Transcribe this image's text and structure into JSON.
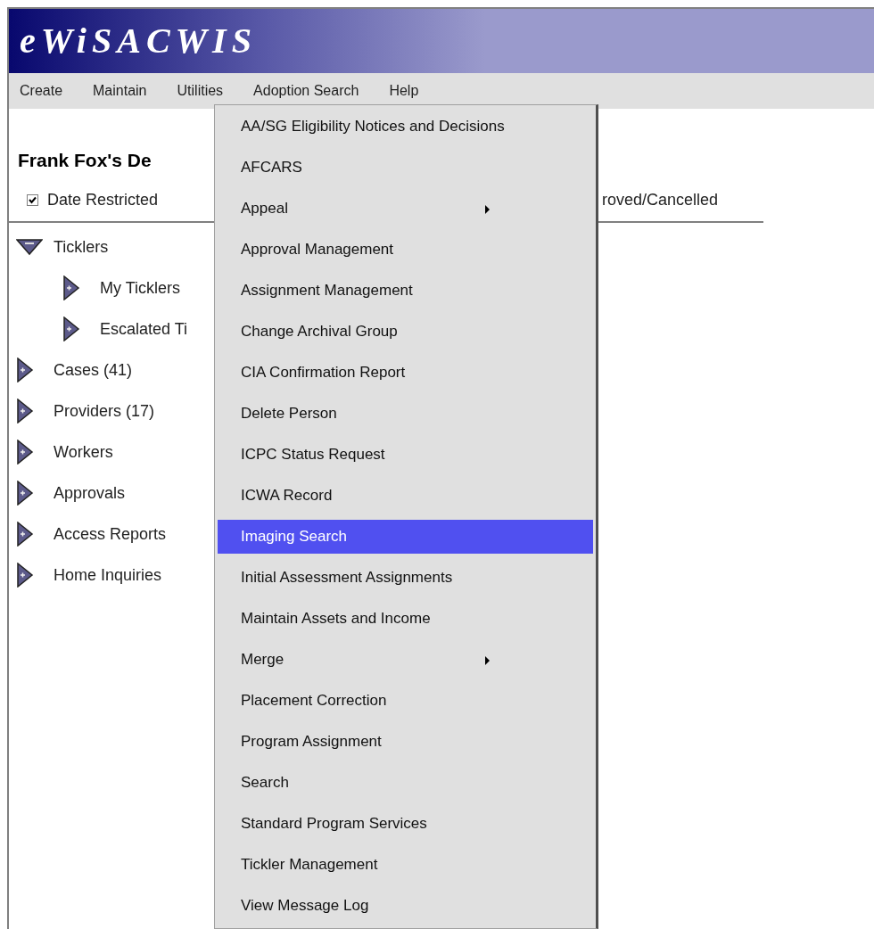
{
  "app": {
    "title": "eWiSACWIS"
  },
  "menu_bar": [
    {
      "label": "Create"
    },
    {
      "label": "Maintain"
    },
    {
      "label": "Utilities"
    },
    {
      "label": "Adoption Search"
    },
    {
      "label": "Help"
    }
  ],
  "page": {
    "heading": "Frank Fox's De",
    "filters": [
      {
        "label": "Date Restricted",
        "checked": true
      }
    ],
    "filter_tail": "roved/Cancelled"
  },
  "tree": [
    {
      "label": "Ticklers",
      "expanded": true,
      "children": [
        {
          "label": "My Ticklers",
          "expanded": false
        },
        {
          "label": "Escalated Ti",
          "expanded": false
        }
      ]
    },
    {
      "label": "Cases (41)",
      "expanded": false
    },
    {
      "label": "Providers (17)",
      "expanded": false
    },
    {
      "label": "Workers",
      "expanded": false
    },
    {
      "label": "Approvals",
      "expanded": false
    },
    {
      "label": "Access Reports",
      "expanded": false
    },
    {
      "label": "Home Inquiries",
      "expanded": false
    }
  ],
  "dropdown": [
    {
      "label": "AA/SG Eligibility Notices and Decisions",
      "submenu": false,
      "selected": false
    },
    {
      "label": "AFCARS",
      "submenu": false,
      "selected": false
    },
    {
      "label": "Appeal",
      "submenu": true,
      "selected": false
    },
    {
      "label": "Approval Management",
      "submenu": false,
      "selected": false
    },
    {
      "label": "Assignment Management",
      "submenu": false,
      "selected": false
    },
    {
      "label": "Change Archival Group",
      "submenu": false,
      "selected": false
    },
    {
      "label": "CIA Confirmation Report",
      "submenu": false,
      "selected": false
    },
    {
      "label": "Delete Person",
      "submenu": false,
      "selected": false
    },
    {
      "label": "ICPC Status Request",
      "submenu": false,
      "selected": false
    },
    {
      "label": "ICWA Record",
      "submenu": false,
      "selected": false
    },
    {
      "label": "Imaging Search",
      "submenu": false,
      "selected": true
    },
    {
      "label": "Initial Assessment Assignments",
      "submenu": false,
      "selected": false
    },
    {
      "label": "Maintain Assets and Income",
      "submenu": false,
      "selected": false
    },
    {
      "label": "Merge",
      "submenu": true,
      "selected": false
    },
    {
      "label": "Placement Correction",
      "submenu": false,
      "selected": false
    },
    {
      "label": "Program Assignment",
      "submenu": false,
      "selected": false
    },
    {
      "label": "Search",
      "submenu": false,
      "selected": false
    },
    {
      "label": "Standard Program Services",
      "submenu": false,
      "selected": false
    },
    {
      "label": "Tickler Management",
      "submenu": false,
      "selected": false
    },
    {
      "label": "View Message Log",
      "submenu": false,
      "selected": false
    }
  ]
}
